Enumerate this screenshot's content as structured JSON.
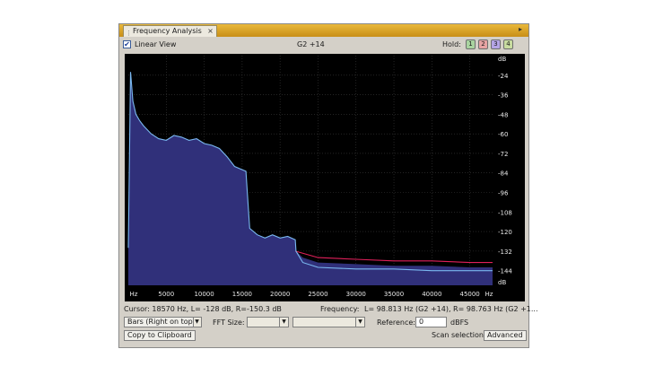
{
  "tab": {
    "title": "Frequency Analysis",
    "close": "×"
  },
  "panel_menu": "▸",
  "top": {
    "linear_view_checked": true,
    "linear_view_label": "Linear View",
    "note": "G2 +14",
    "hold_label": "Hold:",
    "hold_buttons": [
      {
        "label": "1",
        "color": "#a9d3a0"
      },
      {
        "label": "2",
        "color": "#e6a3a3"
      },
      {
        "label": "3",
        "color": "#b5a5e6"
      },
      {
        "label": "4",
        "color": "#c8dca0"
      }
    ]
  },
  "y_ticks": [
    "dB",
    "-24",
    "-36",
    "-48",
    "-60",
    "-72",
    "-84",
    "-96",
    "-108",
    "-120",
    "-132",
    "-144",
    "dB"
  ],
  "x_ticks": [
    "Hz",
    "5000",
    "10000",
    "15000",
    "20000",
    "25000",
    "30000",
    "35000",
    "40000",
    "45000",
    "Hz"
  ],
  "cursor": {
    "text": "Cursor:   18570 Hz, L=  -128 dB, R=-150.3 dB",
    "freq_label": "Frequency:",
    "freq_value": "L=  98.813 Hz (G2 +14), R=  98.763 Hz (G2 +1..."
  },
  "controls": {
    "display_mode": "Bars (Right on top)",
    "fft_label": "FFT Size:",
    "fft_value": "",
    "window_value": "",
    "reference_label": "Reference:",
    "reference_value": "0",
    "reference_unit": "dBFS"
  },
  "buttons": {
    "copy": "Copy to Clipboard",
    "scan": "Scan selection",
    "advanced": "Advanced"
  },
  "chart_data": {
    "type": "area",
    "x_unit": "Hz",
    "y_unit": "dB",
    "xlim": [
      0,
      48000
    ],
    "ylim": [
      -153,
      -12
    ],
    "series": [
      {
        "color": "#30307a",
        "x": [
          0,
          300,
          600,
          1000,
          1500,
          2000,
          3000,
          4000,
          5000,
          6000,
          7000,
          8000,
          9000,
          10000,
          11000,
          12000,
          13000,
          14000,
          15000,
          15500,
          16000,
          17000,
          18000,
          19000,
          20000,
          21000,
          22000,
          22100,
          23000,
          25000,
          30000,
          35000,
          40000,
          45000,
          48000
        ],
        "y": [
          -130,
          -22,
          -40,
          -48,
          -52,
          -55,
          -60,
          -63,
          -64,
          -61,
          -62,
          -64,
          -63,
          -66,
          -67,
          -69,
          -74,
          -80,
          -82,
          -83,
          -118,
          -122,
          -124,
          -122,
          -124,
          -123,
          -125,
          -132,
          -136,
          -139,
          -140,
          -141,
          -141,
          -142,
          -142
        ]
      },
      {
        "color": "#e0205a",
        "x": [
          22000,
          25000,
          30000,
          35000,
          40000,
          45000,
          48000
        ],
        "y": [
          -132,
          -136,
          -137,
          -138,
          -138,
          -139,
          -139
        ]
      },
      {
        "color": "#7ab8f0",
        "x": [
          0,
          300,
          600,
          1000,
          1500,
          2000,
          3000,
          4000,
          5000,
          6000,
          7000,
          8000,
          9000,
          10000,
          11000,
          12000,
          13000,
          14000,
          15000,
          15500,
          16000,
          17000,
          18000,
          19000,
          20000,
          21000,
          22000,
          22100,
          23000,
          25000,
          30000,
          35000,
          40000,
          45000,
          48000
        ],
        "y": [
          -130,
          -22,
          -40,
          -48,
          -52,
          -55,
          -60,
          -63,
          -64,
          -61,
          -62,
          -64,
          -63,
          -66,
          -67,
          -69,
          -74,
          -80,
          -82,
          -83,
          -118,
          -122,
          -124,
          -122,
          -124,
          -123,
          -125,
          -132,
          -139,
          -142,
          -143,
          -143,
          -144,
          -144,
          -144
        ]
      }
    ]
  }
}
